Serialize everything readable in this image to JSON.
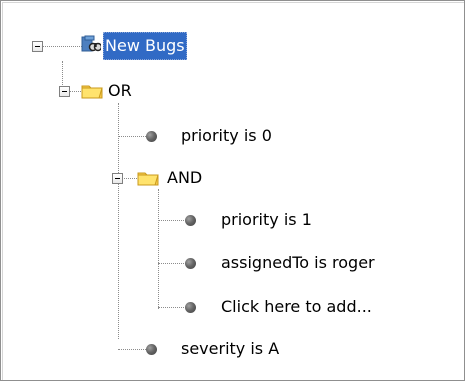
{
  "tree": {
    "root": {
      "label": "New Bugs",
      "icon": "binoculars-icon"
    },
    "or_group": {
      "label": "OR",
      "icon": "folder-icon"
    },
    "or_children": {
      "priority_0": "priority is 0",
      "severity": "severity is A"
    },
    "and_group": {
      "label": "AND",
      "icon": "folder-icon"
    },
    "and_children": {
      "priority_1": "priority is 1",
      "assigned_to": "assignedTo is roger",
      "add_prompt": " Click here to add..."
    }
  },
  "colors": {
    "selection": "#316ac5",
    "folder": "#f7c94b",
    "bullet": "#555555",
    "tree_lines": "#8c8c8c"
  }
}
